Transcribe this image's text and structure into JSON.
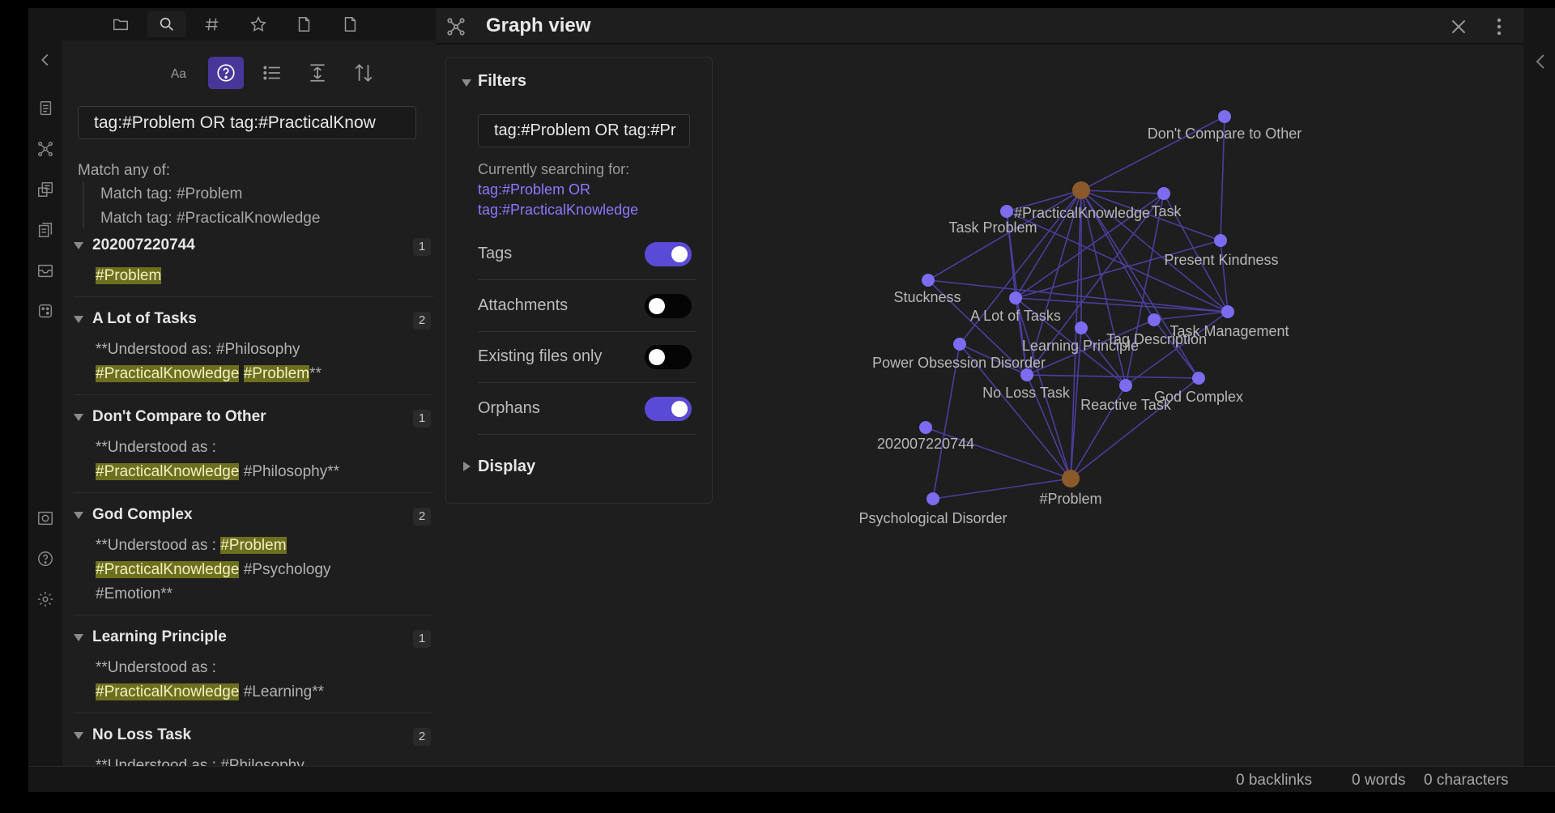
{
  "left_sidebar": {
    "search_query": "tag:#Problem OR tag:#PracticalKnow",
    "match_any_label": "Match any of:",
    "match_lines": [
      "Match tag: #Problem",
      "Match tag: #PracticalKnowledge"
    ],
    "results": [
      {
        "title": "202007220744",
        "count": "1",
        "lines": [
          [
            {
              "t": "#Problem",
              "hl": true
            }
          ]
        ]
      },
      {
        "title": "A Lot of Tasks",
        "count": "2",
        "lines": [
          [
            {
              "t": "**Understood as: #Philosophy",
              "hl": false
            }
          ],
          [
            {
              "t": "#PracticalKnowledge",
              "hl": true
            },
            {
              "t": " ",
              "hl": false
            },
            {
              "t": "#Problem",
              "hl": true
            },
            {
              "t": "**",
              "hl": false
            }
          ]
        ]
      },
      {
        "title": "Don't Compare to Other",
        "count": "1",
        "lines": [
          [
            {
              "t": "**Understood as :",
              "hl": false
            }
          ],
          [
            {
              "t": "#PracticalKnowledge",
              "hl": true
            },
            {
              "t": " #Philosophy**",
              "hl": false
            }
          ]
        ]
      },
      {
        "title": "God Complex",
        "count": "2",
        "lines": [
          [
            {
              "t": "**Understood as : ",
              "hl": false
            },
            {
              "t": "#Problem",
              "hl": true
            }
          ],
          [
            {
              "t": "#PracticalKnowledge",
              "hl": true
            },
            {
              "t": " #Psychology",
              "hl": false
            }
          ],
          [
            {
              "t": "#Emotion**",
              "hl": false
            }
          ]
        ]
      },
      {
        "title": "Learning Principle",
        "count": "1",
        "lines": [
          [
            {
              "t": "**Understood as :",
              "hl": false
            }
          ],
          [
            {
              "t": "#PracticalKnowledge",
              "hl": true
            },
            {
              "t": " #Learning**",
              "hl": false
            }
          ]
        ]
      },
      {
        "title": "No Loss Task",
        "count": "2",
        "lines": [
          [
            {
              "t": "**Understood as : #Philosophy",
              "hl": false
            }
          ]
        ]
      }
    ]
  },
  "graph_pane": {
    "title": "Graph view",
    "filters": {
      "title": "Filters",
      "search_value": "tag:#Problem OR tag:#Pr",
      "currently_searching_label": "Currently searching for:",
      "query_line_1": "tag:#Problem OR",
      "query_line_2": "tag:#PracticalKnowledge",
      "toggles": [
        {
          "label": "Tags",
          "on": true
        },
        {
          "label": "Attachments",
          "on": false
        },
        {
          "label": "Existing files only",
          "on": false
        },
        {
          "label": "Orphans",
          "on": true
        }
      ],
      "display_label": "Display"
    },
    "graph": {
      "nodes": [
        {
          "id": "dont",
          "label": "Don't Compare to Other",
          "kind": "note"
        },
        {
          "id": "pk",
          "label": "#PracticalKnowledge",
          "kind": "tag"
        },
        {
          "id": "task",
          "label": "Task",
          "kind": "note"
        },
        {
          "id": "taskproblem",
          "label": "Task Problem",
          "kind": "note"
        },
        {
          "id": "kindness",
          "label": "Present Kindness",
          "kind": "note"
        },
        {
          "id": "stuck",
          "label": "Stuckness",
          "kind": "note"
        },
        {
          "id": "alot",
          "label": "A Lot of Tasks",
          "kind": "note"
        },
        {
          "id": "tm",
          "label": "Task Management",
          "kind": "note"
        },
        {
          "id": "learn",
          "label": "Learning Principle",
          "kind": "note"
        },
        {
          "id": "tagdesc",
          "label": "Tag Description",
          "kind": "note"
        },
        {
          "id": "power",
          "label": "Power Obsession Disorder",
          "kind": "note"
        },
        {
          "id": "noloss",
          "label": "No Loss Task",
          "kind": "note"
        },
        {
          "id": "reactive",
          "label": "Reactive Task",
          "kind": "note"
        },
        {
          "id": "god",
          "label": "God Complex",
          "kind": "note"
        },
        {
          "id": "n2020",
          "label": "202007220744",
          "kind": "note"
        },
        {
          "id": "problem",
          "label": "#Problem",
          "kind": "tag"
        },
        {
          "id": "psych",
          "label": "Psychological Disorder",
          "kind": "note"
        }
      ],
      "edges": [
        [
          "pk",
          "dont"
        ],
        [
          "dont",
          "kindness"
        ],
        [
          "pk",
          "task"
        ],
        [
          "pk",
          "taskproblem"
        ],
        [
          "pk",
          "kindness"
        ],
        [
          "pk",
          "stuck"
        ],
        [
          "pk",
          "alot"
        ],
        [
          "pk",
          "learn"
        ],
        [
          "pk",
          "tagdesc"
        ],
        [
          "pk",
          "tm"
        ],
        [
          "pk",
          "god"
        ],
        [
          "pk",
          "reactive"
        ],
        [
          "pk",
          "noloss"
        ],
        [
          "pk",
          "power"
        ],
        [
          "pk",
          "problem"
        ],
        [
          "task",
          "alot"
        ],
        [
          "task",
          "reactive"
        ],
        [
          "task",
          "tm"
        ],
        [
          "task",
          "noloss"
        ],
        [
          "taskproblem",
          "alot"
        ],
        [
          "taskproblem",
          "tm"
        ],
        [
          "taskproblem",
          "noloss"
        ],
        [
          "kindness",
          "tm"
        ],
        [
          "kindness",
          "alot"
        ],
        [
          "stuck",
          "tm"
        ],
        [
          "stuck",
          "noloss"
        ],
        [
          "alot",
          "tm"
        ],
        [
          "alot",
          "reactive"
        ],
        [
          "alot",
          "problem"
        ],
        [
          "alot",
          "noloss"
        ],
        [
          "tagdesc",
          "tm"
        ],
        [
          "tagdesc",
          "god"
        ],
        [
          "tagdesc",
          "noloss"
        ],
        [
          "learn",
          "reactive"
        ],
        [
          "learn",
          "problem"
        ],
        [
          "power",
          "problem"
        ],
        [
          "power",
          "psych"
        ],
        [
          "power",
          "noloss"
        ],
        [
          "noloss",
          "problem"
        ],
        [
          "noloss",
          "god"
        ],
        [
          "reactive",
          "problem"
        ],
        [
          "god",
          "problem"
        ],
        [
          "n2020",
          "problem"
        ],
        [
          "psych",
          "problem"
        ],
        [
          "tm",
          "reactive"
        ]
      ],
      "colors": {
        "note": "#7b6cf0",
        "tag": "#8a5a2b",
        "edge": "#4a3e9c",
        "label": "#b8b8b8"
      }
    }
  },
  "status_bar": {
    "backlinks": "0 backlinks",
    "words": "0 words",
    "characters": "0 characters"
  },
  "icons": {
    "ribbon": [
      "collapse-left-icon",
      "files-icon",
      "graph-icon",
      "canvas-icon",
      "templates-icon",
      "archive-icon",
      "random-icon",
      "vault-icon",
      "help-icon",
      "settings-icon"
    ],
    "sidebar_tabs": [
      "folder-icon",
      "search-icon",
      "tag-icon",
      "star-icon",
      "file-icon",
      "file-icon"
    ]
  }
}
